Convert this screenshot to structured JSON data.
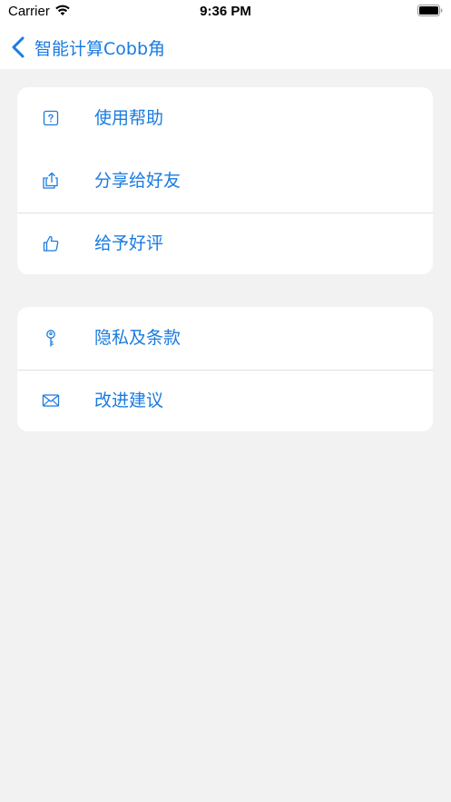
{
  "status_bar": {
    "carrier": "Carrier",
    "time": "9:36 PM"
  },
  "nav": {
    "title": "智能计算Cobb角",
    "back_icon": "chevron-left-icon"
  },
  "colors": {
    "accent": "#1a7be0",
    "background": "#f2f2f2",
    "card": "#ffffff",
    "divider": "#e0e0e0"
  },
  "sections": [
    {
      "items": [
        {
          "label": "使用帮助",
          "icon": "help-icon"
        },
        {
          "label": "分享给好友",
          "icon": "share-icon"
        },
        {
          "label": "给予好评",
          "icon": "thumbs-up-icon"
        }
      ]
    },
    {
      "items": [
        {
          "label": "隐私及条款",
          "icon": "key-icon"
        },
        {
          "label": "改进建议",
          "icon": "mail-icon"
        }
      ]
    }
  ]
}
